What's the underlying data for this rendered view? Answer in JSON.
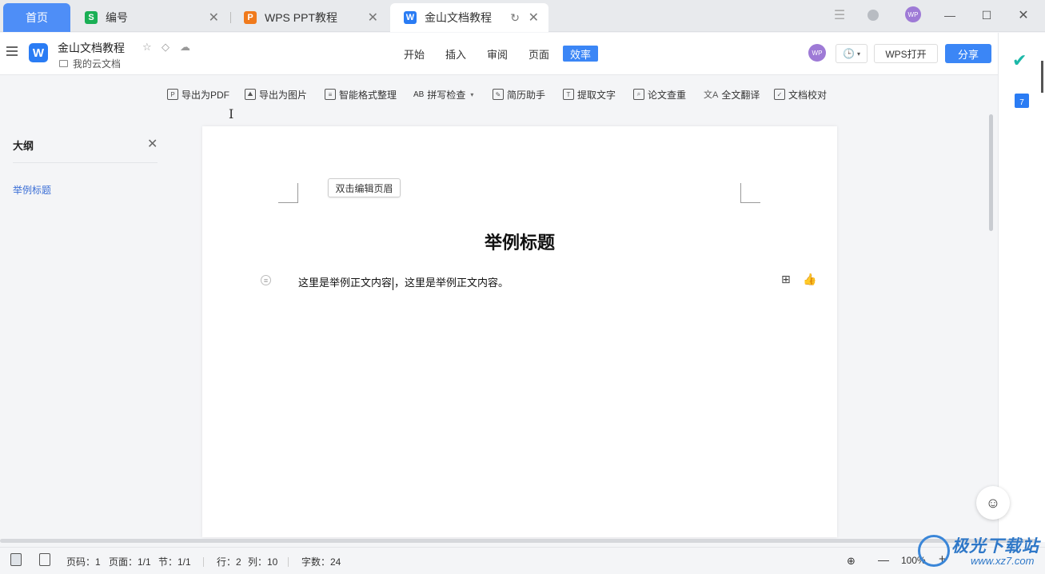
{
  "tabs": {
    "home": "首页",
    "items": [
      {
        "label": "编号",
        "icon": "S",
        "color": "#1aaf55"
      },
      {
        "label": "WPS PPT教程",
        "icon": "P",
        "color": "#f07a1c"
      },
      {
        "label": "金山文档教程",
        "icon": "W",
        "color": "#2a7cf4"
      }
    ]
  },
  "header": {
    "logo": "W",
    "doc_title": "金山文档教程",
    "location": "我的云文档",
    "menus": [
      "开始",
      "插入",
      "审阅",
      "页面",
      "效率"
    ],
    "active_menu": "效率",
    "avatar_text": "WP",
    "wps_open": "WPS打开",
    "share": "分享"
  },
  "toolbar": {
    "items": [
      "导出为PDF",
      "导出为图片",
      "智能格式整理",
      "拼写检查",
      "简历助手",
      "提取文字",
      "论文查重",
      "全文翻译",
      "文档校对"
    ]
  },
  "outline": {
    "title": "大纲",
    "items": [
      "举例标题"
    ]
  },
  "document": {
    "header_tip": "双击编辑页眉",
    "heading": "举例标题",
    "para_before_caret": "这里是举例正文内容",
    "para_after_caret": "，这里是举例正文内容。"
  },
  "statusbar": {
    "page_no": "页码：1",
    "pages": "页面：1/1",
    "section": "节：1/1",
    "row": "行：2",
    "col": "列：10",
    "words": "字数：24",
    "zoom": "100%"
  },
  "watermark": {
    "text": "极光下载站",
    "url": "www.xz7.com"
  }
}
